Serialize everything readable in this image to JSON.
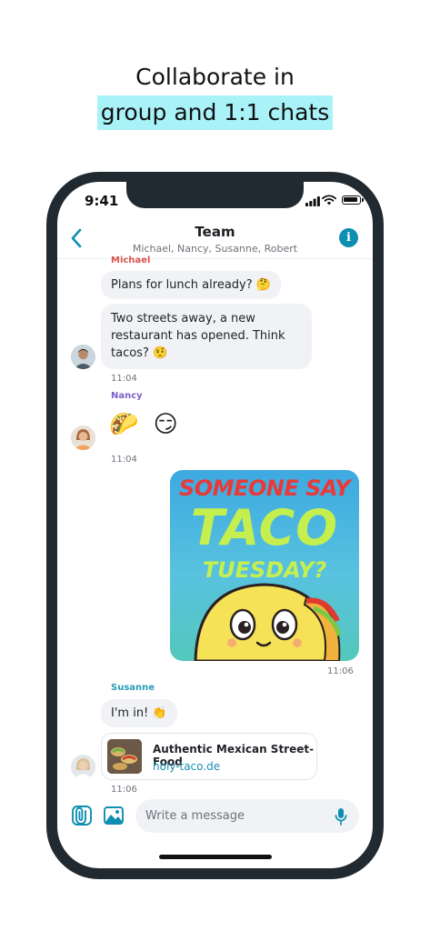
{
  "headline": {
    "line1": "Collaborate in",
    "line2": "group and 1:1 chats"
  },
  "status_bar": {
    "time": "9:41"
  },
  "chat_header": {
    "title": "Team",
    "members": "Michael, Nancy, Susanne, Robert"
  },
  "messages": {
    "michael": {
      "sender": "Michael",
      "msg1": "Plans for lunch already? 🤔",
      "msg2_line1": "Two streets away, a new",
      "msg2_line2": "restaurant has opened. Think",
      "msg2_line3": "tacos? 🤨",
      "time": "11:04"
    },
    "nancy": {
      "sender": "Nancy",
      "emojis": "🌮 😏",
      "time": "11:04"
    },
    "sticker": {
      "line1": "SOMEONE SAY",
      "line2": "TACO",
      "line3": "TUESDAY?",
      "time": "11:06"
    },
    "susanne": {
      "sender": "Susanne",
      "msg1": "I'm in! 👏",
      "link_title": "Authentic Mexican Street-Food",
      "link_url": "holy-taco.de",
      "time": "11:06"
    }
  },
  "composer": {
    "placeholder": "Write a message"
  },
  "colors": {
    "accent": "#0e8fb1",
    "michael": "#d9534f",
    "nancy": "#7a5fc9",
    "susanne": "#2a9bb5",
    "highlight": "#a8f2f8"
  }
}
